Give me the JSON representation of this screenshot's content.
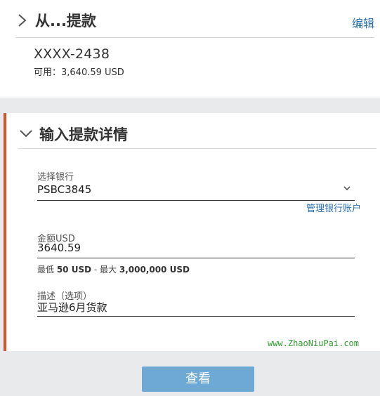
{
  "from_card": {
    "title": "从...提款",
    "edit_label": "编辑",
    "account_number": "XXXX-2438",
    "available_text": "可用：3,640.59 USD"
  },
  "details_card": {
    "title": "输入提款详情",
    "bank_label": "选择银行",
    "bank_value": "PSBC3845",
    "manage_accounts_label": "管理银行账户",
    "amount_label": "金额USD",
    "amount_value": "3640.59",
    "limit_min_prefix": "最低 ",
    "limit_min_value": "50 USD",
    "limit_separator": " - 最大 ",
    "limit_max_value": "3,000,000 USD",
    "description_label": "描述（选项）",
    "description_value": "亚马逊6月货款"
  },
  "watermark": "www.ZhaoNiuPai.com",
  "actions": {
    "view_label": "查看"
  },
  "colors": {
    "accent_border": "#d9532b",
    "link": "#2a6fb0",
    "button_bg": "#6ea9d6",
    "watermark": "#2e9b2e"
  },
  "icons": {
    "from_toggle": "chevron-right-icon",
    "details_toggle": "chevron-down-icon",
    "bank_dropdown": "chevron-down-icon"
  }
}
